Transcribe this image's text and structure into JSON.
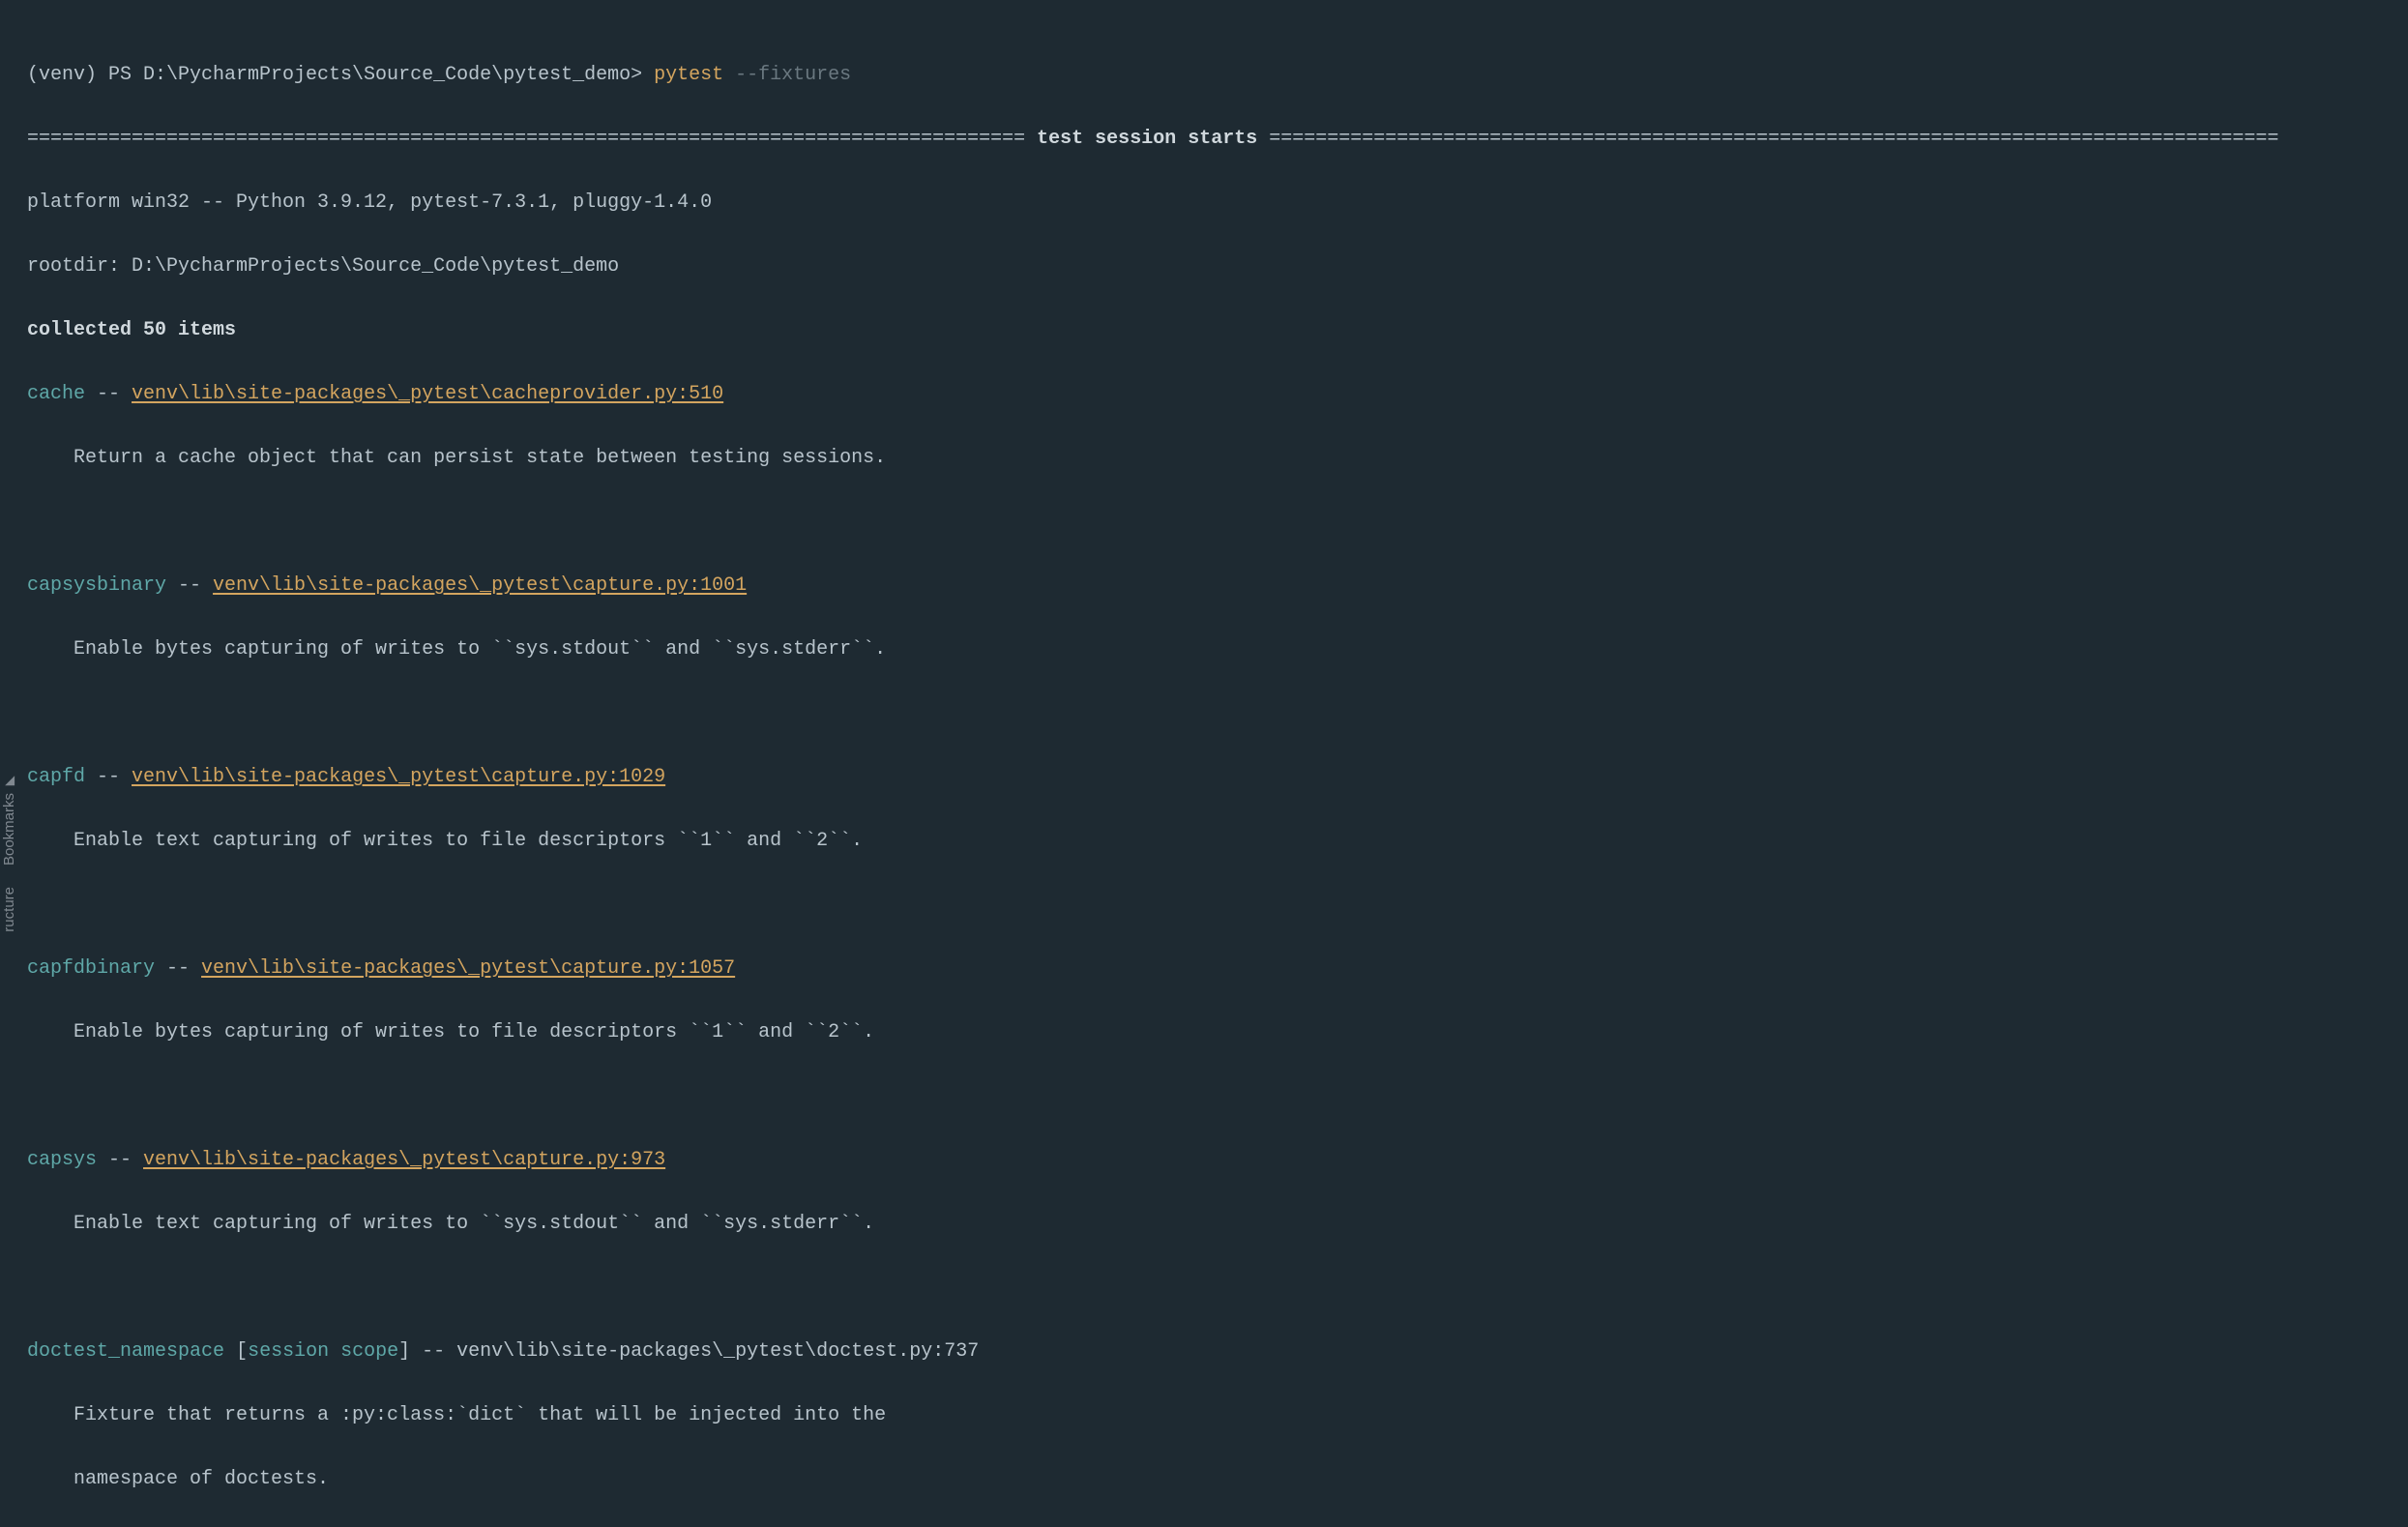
{
  "prompt": {
    "venv_path": "(venv) PS D:\\PycharmProjects\\Source_Code\\pytest_demo>",
    "command": "pytest",
    "flag": "--fixtures"
  },
  "session_header": {
    "divider_left": "====================================================================================== ",
    "title": "test session starts",
    "divider_right": " ======================================================================================="
  },
  "platform_line": "platform win32 -- Python 3.9.12, pytest-7.3.1, pluggy-1.4.0",
  "rootdir_line": "rootdir: D:\\PycharmProjects\\Source_Code\\pytest_demo",
  "collected_line": "collected 50 items",
  "fixtures": [
    {
      "name": "cache",
      "sep": " -- ",
      "path": "venv\\lib\\site-packages\\_pytest\\cacheprovider.py:510",
      "desc": "    Return a cache object that can persist state between testing sessions."
    },
    {
      "name": "capsysbinary",
      "sep": " -- ",
      "path": "venv\\lib\\site-packages\\_pytest\\capture.py:1001",
      "desc": "    Enable bytes capturing of writes to ``sys.stdout`` and ``sys.stderr``."
    },
    {
      "name": "capfd",
      "sep": " -- ",
      "path": "venv\\lib\\site-packages\\_pytest\\capture.py:1029",
      "desc": "    Enable text capturing of writes to file descriptors ``1`` and ``2``."
    },
    {
      "name": "capfdbinary",
      "sep": " -- ",
      "path": "venv\\lib\\site-packages\\_pytest\\capture.py:1057",
      "desc": "    Enable bytes capturing of writes to file descriptors ``1`` and ``2``."
    },
    {
      "name": "capsys",
      "sep": " -- ",
      "path": "venv\\lib\\site-packages\\_pytest\\capture.py:973",
      "desc": "    Enable text capturing of writes to ``sys.stdout`` and ``sys.stderr``."
    }
  ],
  "doctest": {
    "name": "doctest_namespace",
    "scope_open": " [",
    "scope_text": "session scope",
    "scope_close": "]",
    "sep": " -- ",
    "path": "venv\\lib\\site-packages\\_pytest\\doctest.py:737",
    "desc1": "    Fixture that returns a :py:class:`dict` that will be injected into the",
    "desc2": "    namespace of doctests."
  },
  "sidebar": {
    "bookmarks": "Bookmarks",
    "structure": "ructure"
  }
}
